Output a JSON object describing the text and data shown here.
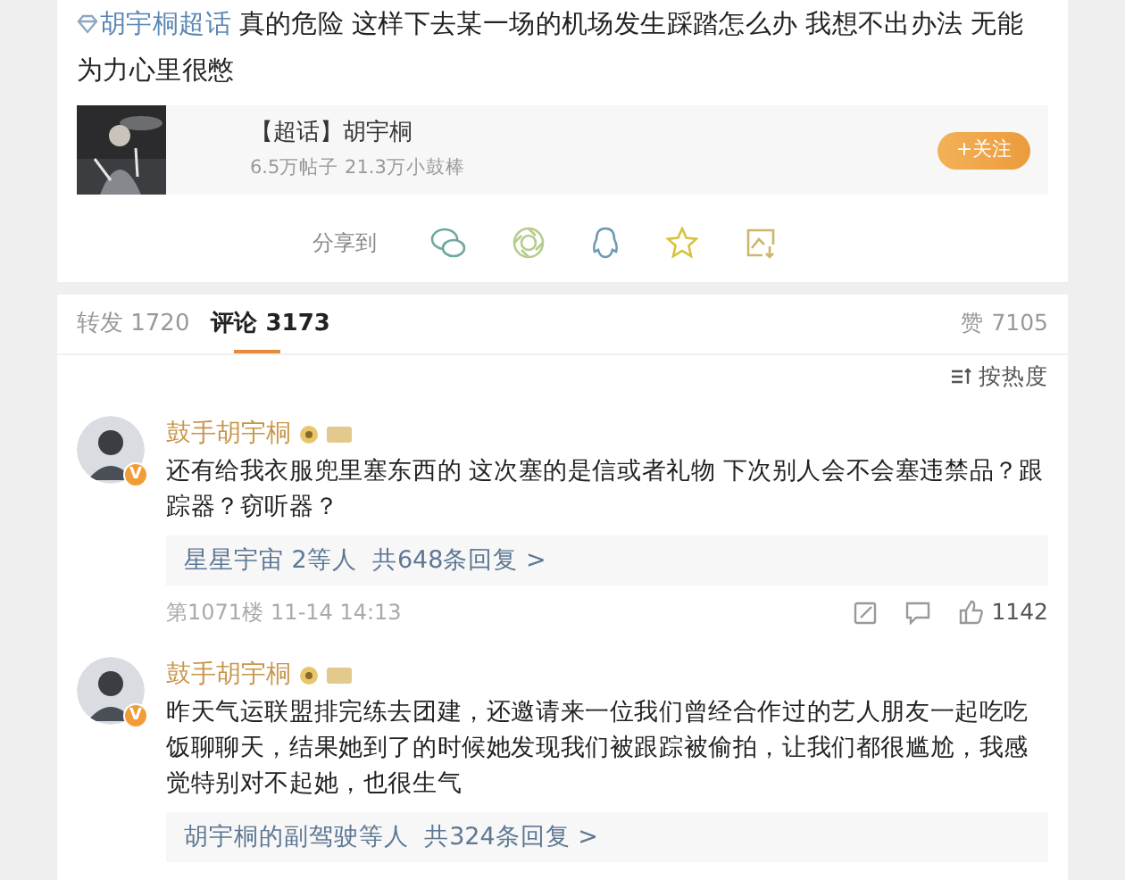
{
  "post": {
    "topic": "胡宇桐超话",
    "text": "真的危险 这样下去某一场的机场发生踩踏怎么办 我想不出办法 无能为力心里很憋",
    "supertopic": {
      "title": "【超话】胡宇桐",
      "stats": "6.5万帖子 21.3万小鼓棒",
      "follow_button": "+关注"
    },
    "share": {
      "label": "分享到"
    }
  },
  "tabs": [
    {
      "label": "转发",
      "count": "1720",
      "selected": false
    },
    {
      "label": "评论",
      "count": "3173",
      "selected": true
    }
  ],
  "likes": {
    "label": "赞",
    "count": "7105"
  },
  "sort": "按热度",
  "comments": [
    {
      "author": "鼓手胡宇桐",
      "verified_badge": "V",
      "text": "还有给我衣服兜里塞东西的 这次塞的是信或者礼物 下次别人会不会塞违禁品？跟踪器？窃听器？",
      "replies": "星星宇宙 2等人  共648条回复 >",
      "floor": "第1071楼",
      "time": "11-14 14:13",
      "likes": "1142"
    },
    {
      "author": "鼓手胡宇桐",
      "verified_badge": "V",
      "text": "昨天气运联盟排完练去团建，还邀请来一位我们曾经合作过的艺人朋友一起吃吃饭聊聊天，结果她到了的时候她发现我们被跟踪被偷拍，让我们都很尴尬，我感觉特别对不起她，也很生气",
      "replies": "胡宇桐的副驾驶等人  共324条回复 >"
    }
  ]
}
